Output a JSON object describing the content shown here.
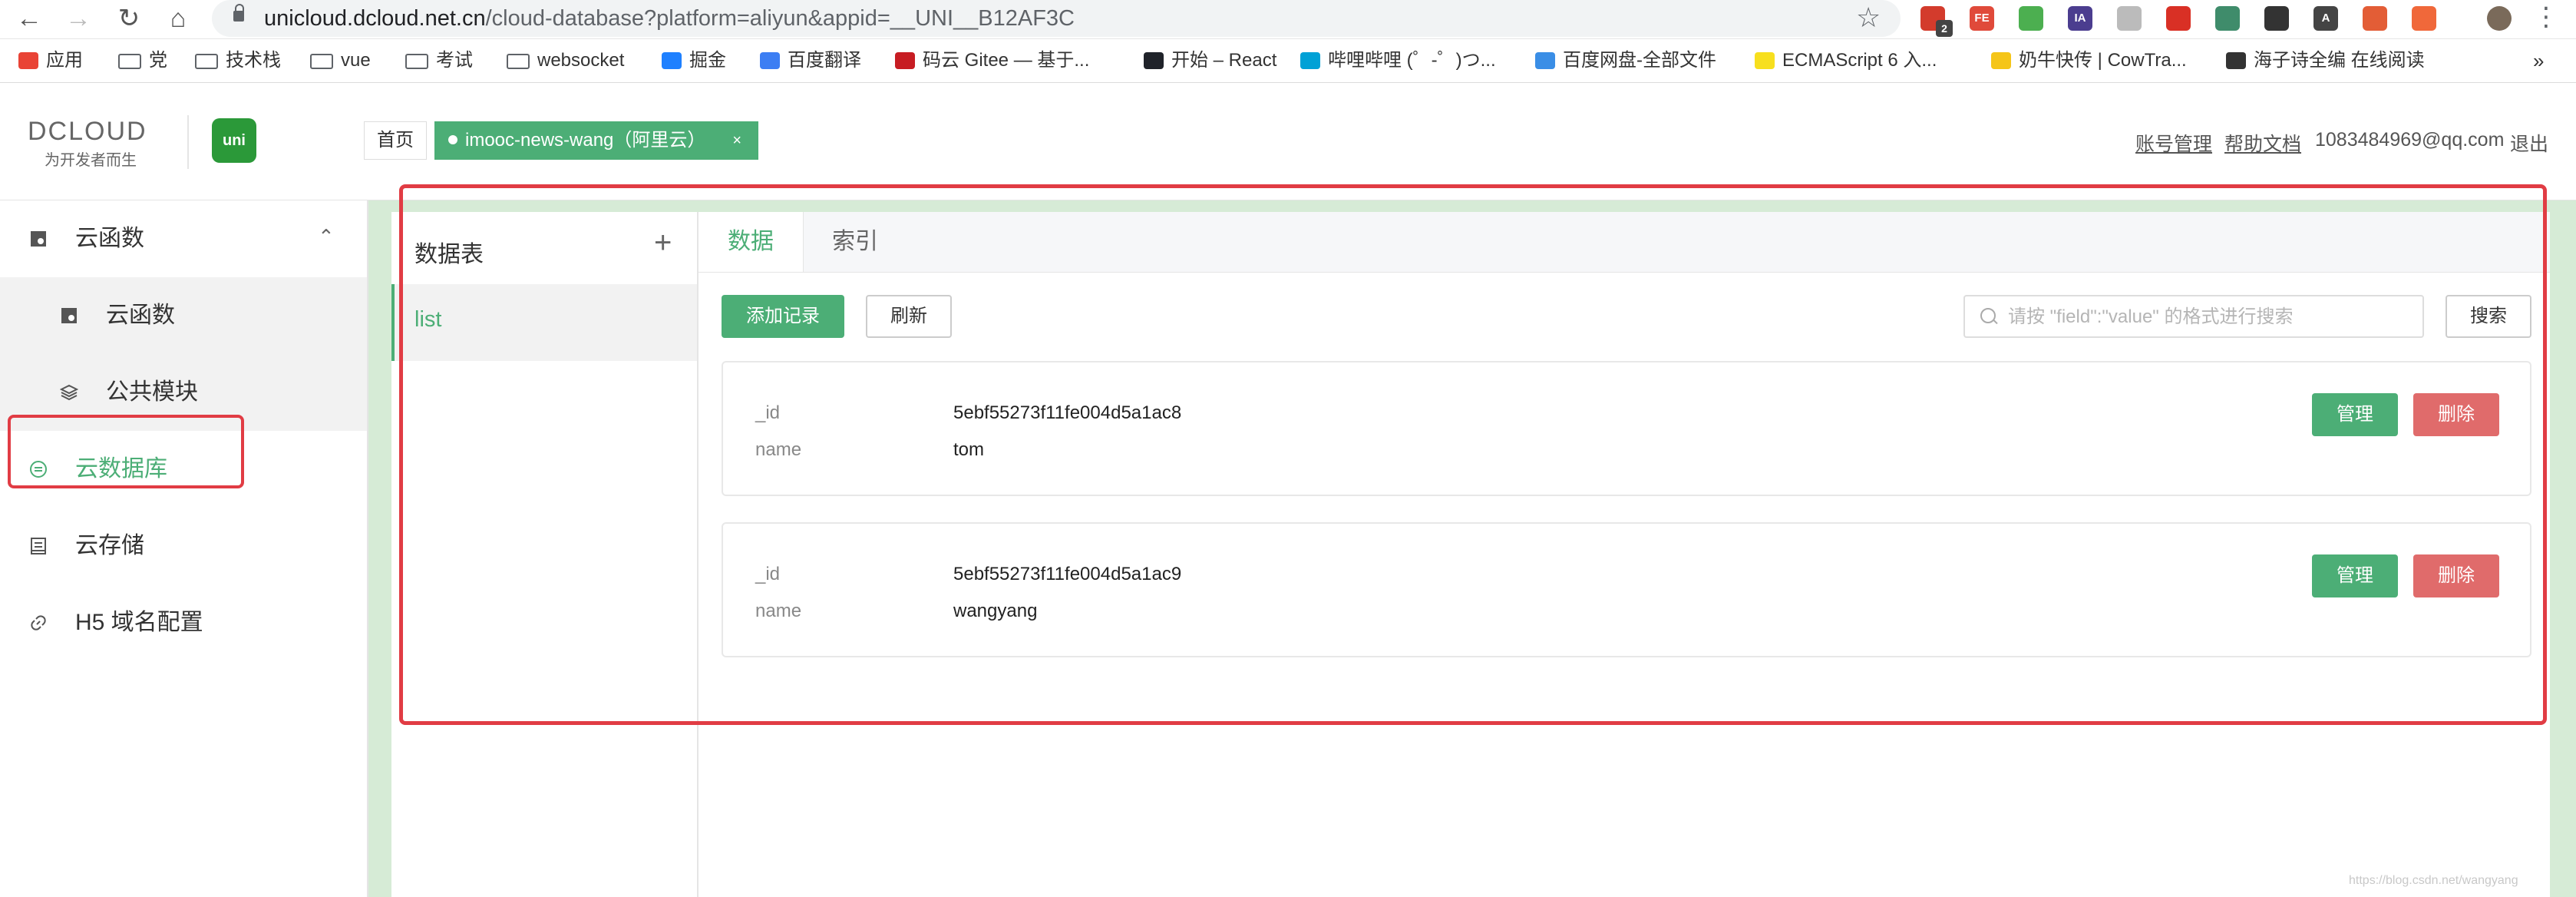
{
  "browser": {
    "url_host": "unicloud.dcloud.net.cn",
    "url_path": "/cloud-database?platform=aliyun&appid=__UNI__B12AF3C",
    "extensions": [
      {
        "name": "ext-red-icon",
        "color": "#d33b2c",
        "text": ""
      },
      {
        "name": "ext-fe-icon",
        "color": "#e04a3a",
        "text": "FE"
      },
      {
        "name": "ext-green-leaf-icon",
        "color": "#4caf50",
        "text": ""
      },
      {
        "name": "ext-ia-icon",
        "color": "#4b3d8f",
        "text": "IA"
      },
      {
        "name": "ext-react-icon",
        "color": "#bbbbbb",
        "text": ""
      },
      {
        "name": "ext-stop-icon",
        "color": "#d93025",
        "text": ""
      },
      {
        "name": "ext-vue-icon",
        "color": "#3f8c6b",
        "text": ""
      },
      {
        "name": "ext-mask-icon",
        "color": "#333333",
        "text": ""
      },
      {
        "name": "ext-a-icon",
        "color": "#444444",
        "text": "A"
      },
      {
        "name": "ext-person-icon",
        "color": "#e35d36",
        "text": ""
      },
      {
        "name": "ext-orange-icon",
        "color": "#f0683a",
        "text": ""
      }
    ],
    "extension_badge": "2"
  },
  "bookmarks": [
    {
      "label": "应用",
      "icon": "apps-grid-icon",
      "color": "#e94335"
    },
    {
      "label": "党",
      "icon": "folder-icon",
      "color": ""
    },
    {
      "label": "技术栈",
      "icon": "folder-icon",
      "color": ""
    },
    {
      "label": "vue",
      "icon": "folder-icon",
      "color": ""
    },
    {
      "label": "考试",
      "icon": "folder-icon",
      "color": ""
    },
    {
      "label": "websocket",
      "icon": "folder-icon",
      "color": ""
    },
    {
      "label": "掘金",
      "icon": "juejin-icon",
      "color": "#1e80ff"
    },
    {
      "label": "百度翻译",
      "icon": "baidu-translate-icon",
      "color": "#3c7ef3"
    },
    {
      "label": "码云 Gitee — 基于...",
      "icon": "gitee-icon",
      "color": "#c71d23"
    },
    {
      "label": "开始 – React",
      "icon": "react-icon",
      "color": "#20232a"
    },
    {
      "label": "哔哩哔哩 (゜-゜)つ...",
      "icon": "bilibili-icon",
      "color": "#00a1d6"
    },
    {
      "label": "百度网盘-全部文件",
      "icon": "baidu-netdisk-icon",
      "color": "#3a8ee6"
    },
    {
      "label": "ECMAScript 6 入...",
      "icon": "es-icon",
      "color": "#f7df1e"
    },
    {
      "label": "奶牛快传 | CowTra...",
      "icon": "cowtransfer-icon",
      "color": "#f5c518"
    },
    {
      "label": "海子诗全编 在线阅读",
      "icon": "book-icon",
      "color": "#333333"
    }
  ],
  "header": {
    "logo_text": "DCLOUD",
    "logo_sub": "为开发者而生",
    "uni_badge": "uni",
    "tab_home": "首页",
    "tab_project": "imooc-news-wang（阿里云）",
    "tab_close": "×",
    "account_manage": "账号管理",
    "help_docs": "帮助文档",
    "email": "1083484969@qq.com",
    "logout": "退出"
  },
  "sidebar": {
    "items": [
      {
        "label": "云函数",
        "icon": "cloud-function-icon"
      },
      {
        "label": "云函数",
        "icon": "cloud-function-icon"
      },
      {
        "label": "公共模块",
        "icon": "layers-icon"
      },
      {
        "label": "云数据库",
        "icon": "database-icon"
      },
      {
        "label": "云存储",
        "icon": "storage-icon"
      },
      {
        "label": "H5 域名配置",
        "icon": "link-icon"
      }
    ]
  },
  "tables_panel": {
    "title": "数据表",
    "add": "+",
    "tables": [
      "list"
    ]
  },
  "tabs": [
    "数据",
    "索引"
  ],
  "toolbar": {
    "add_record": "添加记录",
    "refresh": "刷新",
    "search_placeholder": "请按 \"field\":\"value\" 的格式进行搜索",
    "search_button": "搜索"
  },
  "records": [
    {
      "fields": [
        {
          "key": "_id",
          "value": "5ebf55273f11fe004d5a1ac8"
        },
        {
          "key": "name",
          "value": "tom"
        }
      ],
      "manage": "管理",
      "delete": "删除"
    },
    {
      "fields": [
        {
          "key": "_id",
          "value": "5ebf55273f11fe004d5a1ac9"
        },
        {
          "key": "name",
          "value": "wangyang"
        }
      ],
      "manage": "管理",
      "delete": "删除"
    }
  ],
  "watermark": "https://blog.csdn.net/wangyang"
}
